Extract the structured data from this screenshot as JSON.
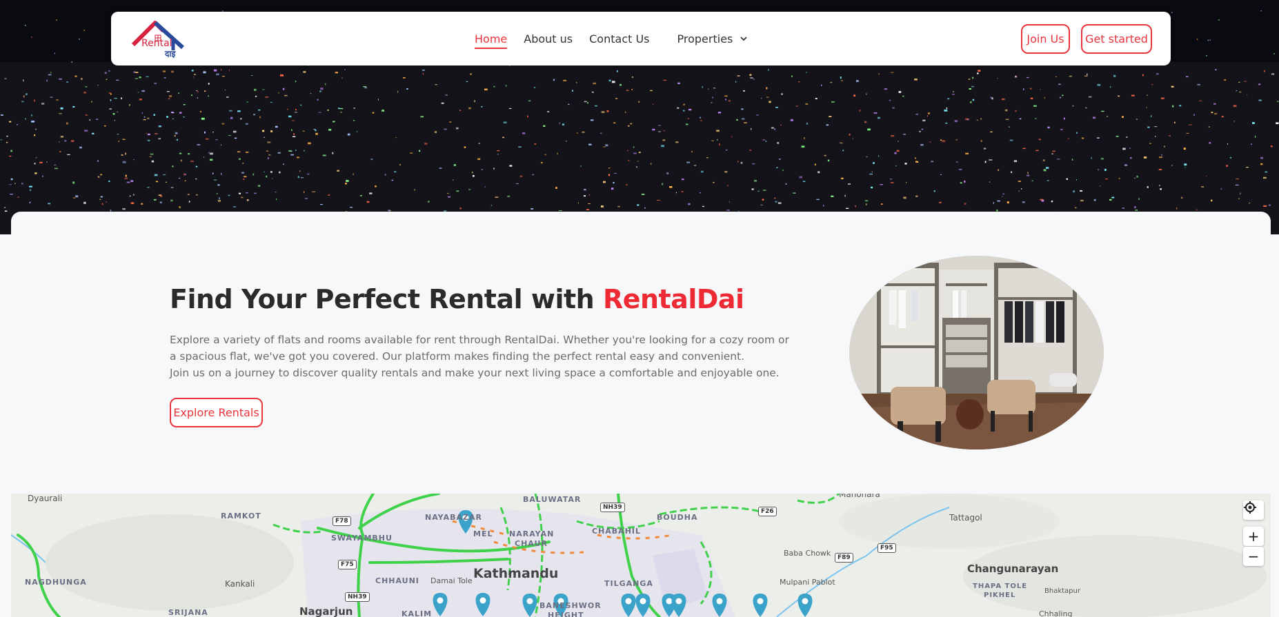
{
  "brand": {
    "logo_text": "Rental",
    "logo_sub": "दाइ"
  },
  "nav": {
    "items": [
      {
        "label": "Home",
        "active": true
      },
      {
        "label": "About us",
        "active": false
      },
      {
        "label": "Contact Us",
        "active": false
      }
    ],
    "dropdown_label": "Properties",
    "join_label": "Join Us",
    "start_label": "Get started"
  },
  "hero": {
    "title_prefix": "Find Your Perfect Rental with ",
    "title_brand": "RentalDai",
    "description_line1": "Explore a variety of flats and rooms available for rent through RentalDai. Whether you're looking for a cozy room or a spacious flat, we've got you covered. Our platform makes finding the perfect rental easy and convenient.",
    "description_line2": "Join us on a journey to discover quality rentals and make your next living space a comfortable and enjoyable one.",
    "cta_label": "Explore Rentals"
  },
  "map": {
    "labels": {
      "dyaurali": "Dyaurali",
      "ramkot": "RAMKOT",
      "nagdhunga": "NAGDHUNGA",
      "kankali": "Kankali",
      "srijana": "SRIJANA",
      "nagarjun": "Nagarjun",
      "swayambhu": "SWAYAMBHU",
      "chhauni": "CHHAUNI",
      "nayabazar": "NAYABAZAR",
      "thamel": "MEL",
      "damai_tole": "Damai Tole",
      "kathmandu": "Kathmandu",
      "kalimati": "KALIM",
      "baluwatar": "BALUWATAR",
      "narayan_chaur_1": "NARAYAN",
      "narayan_chaur_2": "CHAUR",
      "chabahil": "CHABAHIL",
      "tilganga": "TILGANGA",
      "baneshwor_1": "BANESHWOR",
      "baneshwor_2": "HEIGHT",
      "boudha": "BOUDHA",
      "manohara": "Manohara",
      "baba_chowk": "Baba Chowk",
      "mulpani_pablot": "Mulpani Pablot",
      "tattagol": "Tattagol",
      "changunarayan": "Changunarayan",
      "thapa_tole_1": "THAPA TOLE",
      "thapa_tole_2": "PIKHEL",
      "bhaktapur": "Bhaktapur",
      "chhaling": "Chhaling"
    },
    "shields": {
      "f78": "F78",
      "f75": "F75",
      "nh39a": "NH39",
      "nh39b": "NH39",
      "f26": "F26",
      "f89": "F89",
      "f95": "F95"
    },
    "controls": {
      "zoom_in": "+",
      "zoom_out": "−"
    }
  },
  "colors": {
    "accent": "#e8353c",
    "title_dark": "#2b2b2b",
    "marker": "#3ba3c9"
  }
}
